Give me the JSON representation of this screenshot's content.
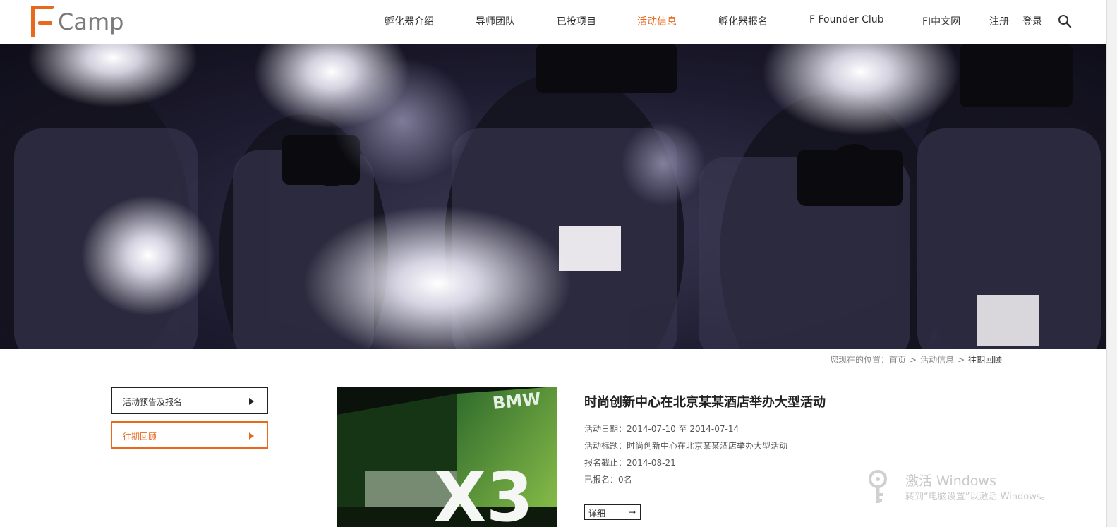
{
  "brand": {
    "logo_text": "Camp",
    "accent_color": "#e8681c"
  },
  "nav": {
    "items": [
      {
        "label": "孵化器介绍",
        "active": false
      },
      {
        "label": "导师团队",
        "active": false
      },
      {
        "label": "已投项目",
        "active": false
      },
      {
        "label": "活动信息",
        "active": true
      },
      {
        "label": "孵化器报名",
        "active": false
      },
      {
        "label": "F Founder Club",
        "active": false
      },
      {
        "label": "FI中文网",
        "active": false
      },
      {
        "label": "注册",
        "active": false
      },
      {
        "label": "登录",
        "active": false
      }
    ],
    "search_icon": "search-icon"
  },
  "breadcrumb": {
    "prefix": "您现在的位置：",
    "home": "首页",
    "sep1": ">",
    "section": "活动信息",
    "sep2": ">",
    "current": "往期回顾"
  },
  "sidebar": {
    "items": [
      {
        "label": "活动预告及报名",
        "active": false
      },
      {
        "label": "往期回顾",
        "active": true
      }
    ]
  },
  "event": {
    "title": "时尚创新中心在北京某某酒店举办大型活动",
    "date_line": "活动日期：2014-07-10 至 2014-07-14",
    "subject_line": "活动标题：时尚创新中心在北京某某酒店举办大型活动",
    "deadline_line": "报名截止：2014-08-21",
    "registered_line": "已报名：0名",
    "detail_label": "详细",
    "detail_arrow": "→",
    "image_text_brand": "BMW",
    "image_text_model": "X3"
  },
  "watermark": {
    "title": "激活 Windows",
    "subtitle": "转到“电脑设置”以激活 Windows。"
  }
}
